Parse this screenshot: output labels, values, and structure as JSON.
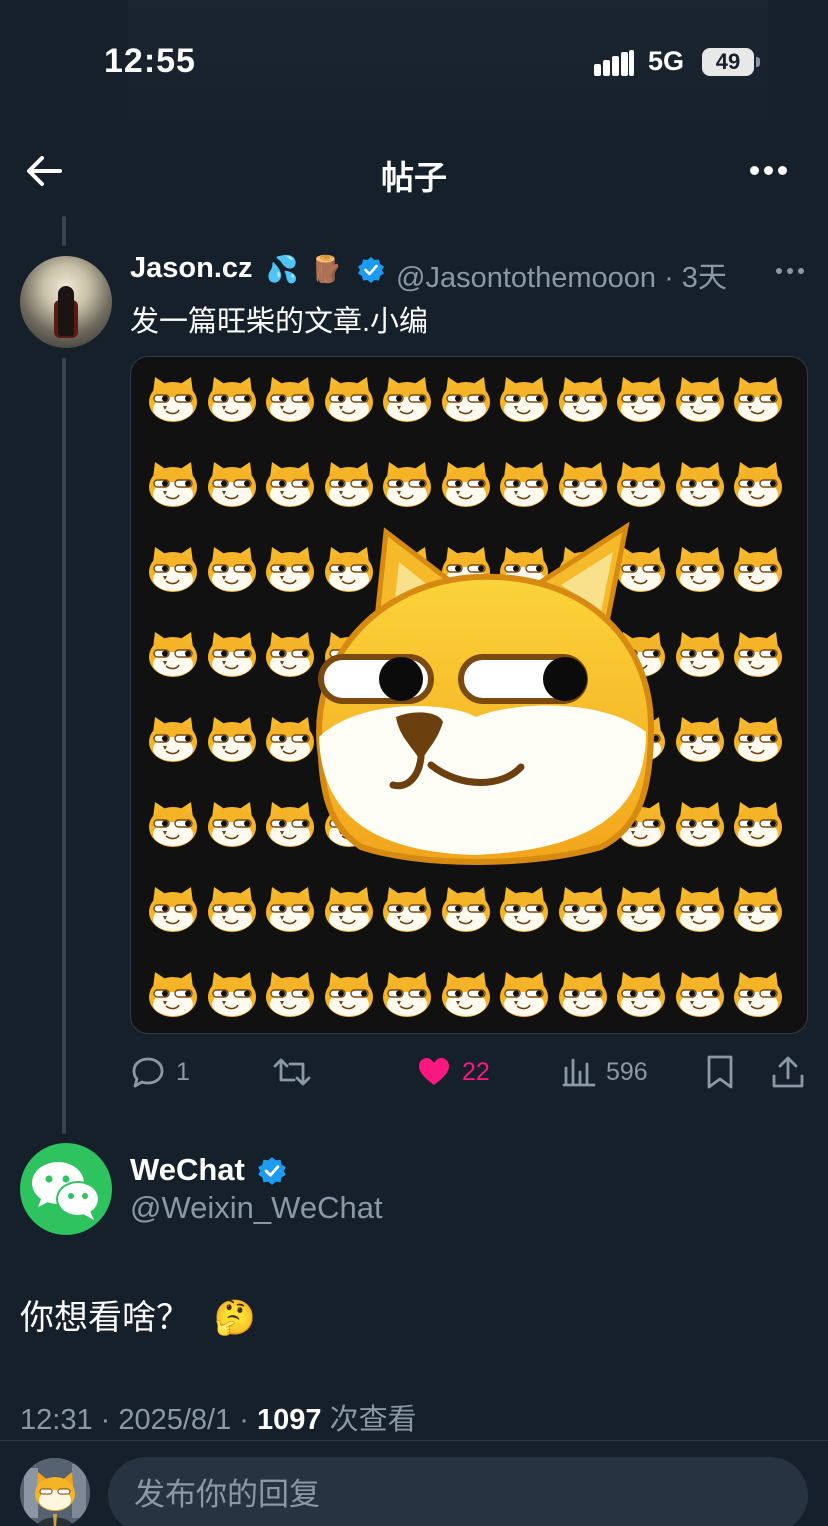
{
  "status_bar": {
    "time": "12:55",
    "network": "5G",
    "battery": "49"
  },
  "header": {
    "title": "帖子"
  },
  "parent_tweet": {
    "name": "Jason.cz",
    "emoji_1": "💦",
    "emoji_2": "🪵",
    "handle": "@Jasontothemooon",
    "separator": "·",
    "time_ago": "3天",
    "text": "发一篇旺柴的文章.小编",
    "media_icon": "doge-emoji-grid",
    "stats": {
      "replies": "1",
      "likes": "22",
      "views": "596"
    }
  },
  "main_tweet": {
    "name": "WeChat",
    "handle": "@Weixin_WeChat",
    "text": "你想看啥？",
    "emoji": "🤔",
    "time": "12:31",
    "date": "2025/8/1",
    "views": "1097",
    "views_label": "次查看"
  },
  "reply": {
    "placeholder": "发布你的回复"
  },
  "colors": {
    "background": "#15202b",
    "like": "#f91880",
    "verified": "#1d9bf0",
    "secondary_text": "#8b98a5",
    "wechat": "#2ec35f"
  }
}
